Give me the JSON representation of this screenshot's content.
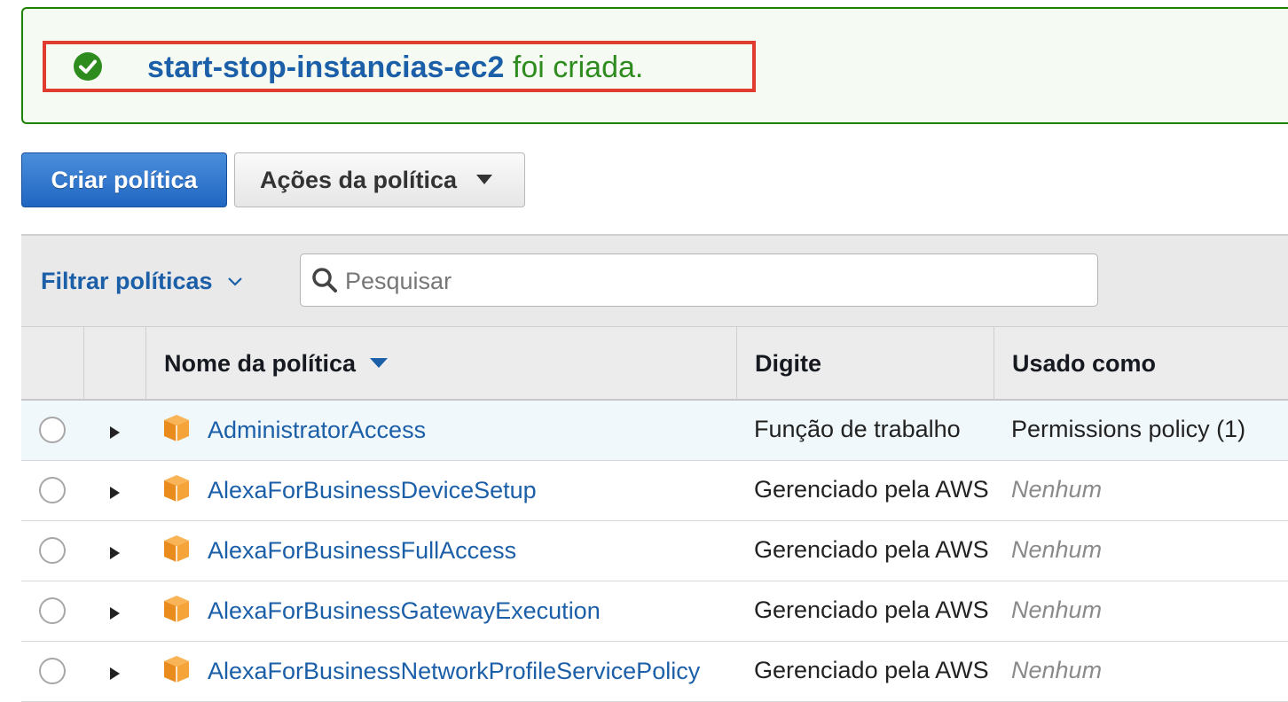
{
  "banner": {
    "policy_name": "start-stop-instancias-ec2",
    "message": "foi criada.",
    "accent_color": "#1d8102",
    "highlight_color": "#e03b2f",
    "icon": "check-circle-icon"
  },
  "toolbar": {
    "create_label": "Criar política",
    "actions_label": "Ações da política"
  },
  "filter": {
    "label": "Filtrar políticas",
    "search_placeholder": "Pesquisar"
  },
  "table": {
    "columns": [
      "",
      "",
      "Nome da política",
      "Digite",
      "Usado como"
    ],
    "rows": [
      {
        "name": "AdministratorAccess",
        "type": "Função de trabalho",
        "used_as": "Permissions policy (1)",
        "highlighted": true
      },
      {
        "name": "AlexaForBusinessDeviceSetup",
        "type": "Gerenciado pela AWS",
        "used_as": "Nenhum"
      },
      {
        "name": "AlexaForBusinessFullAccess",
        "type": "Gerenciado pela AWS",
        "used_as": "Nenhum"
      },
      {
        "name": "AlexaForBusinessGatewayExecution",
        "type": "Gerenciado pela AWS",
        "used_as": "Nenhum"
      },
      {
        "name": "AlexaForBusinessNetworkProfileServicePolicy",
        "type": "Gerenciado pela AWS",
        "used_as": "Nenhum"
      }
    ]
  }
}
